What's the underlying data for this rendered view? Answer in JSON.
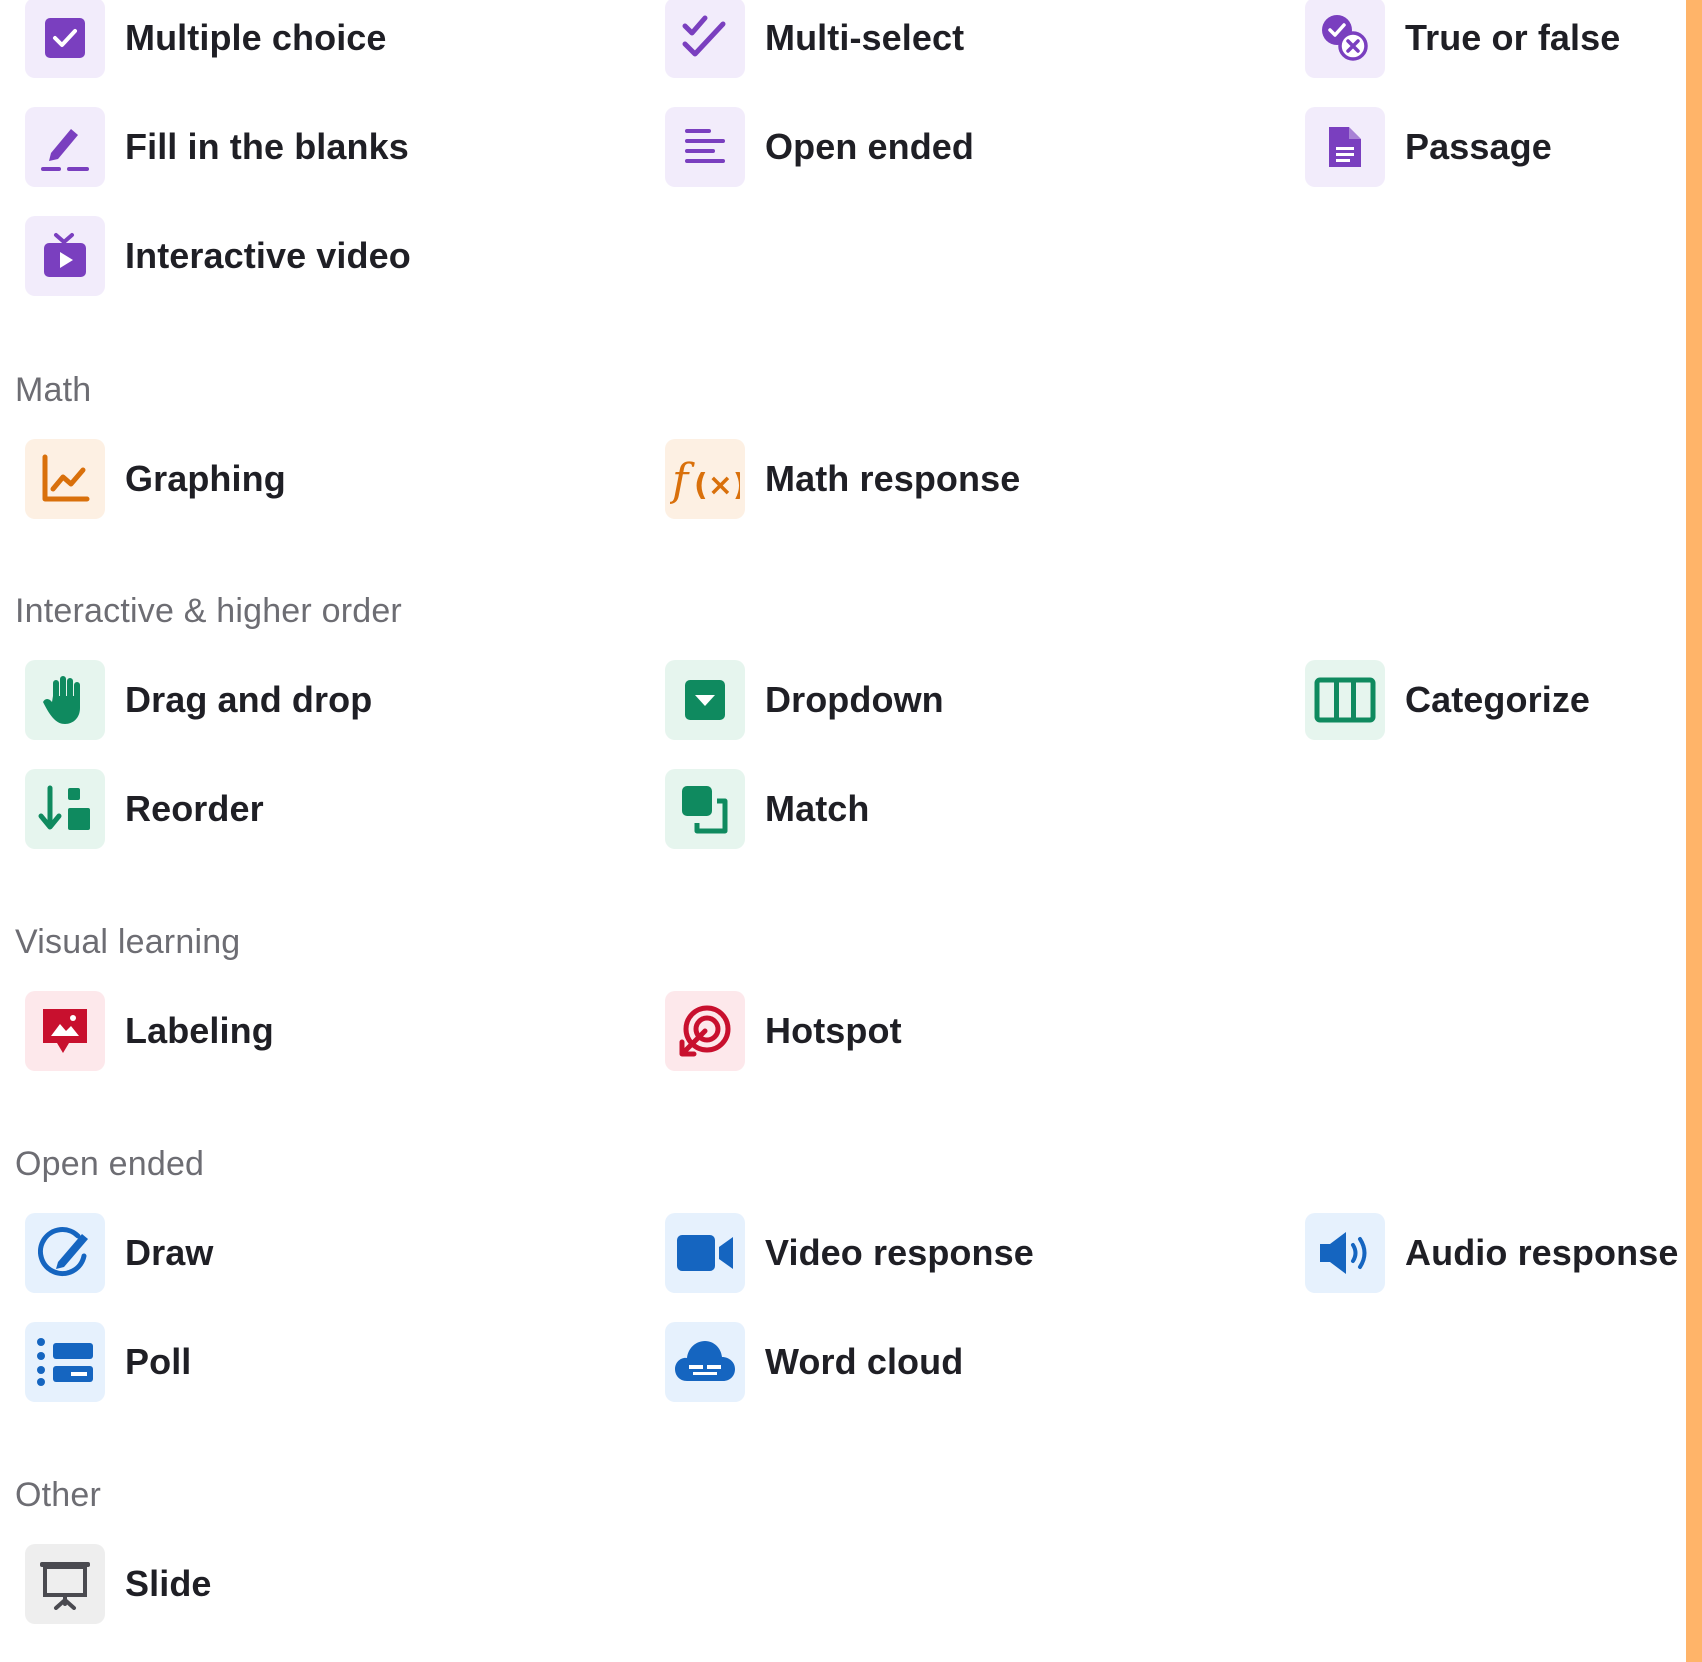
{
  "accent_color": "#ffb469",
  "sections": [
    {
      "title": "",
      "icon_bg": "#f2ecfb",
      "icon_color": "#7a3fbf",
      "items": [
        {
          "label": "Multiple choice",
          "icon": "checkbox-icon"
        },
        {
          "label": "Multi-select",
          "icon": "double-check-icon"
        },
        {
          "label": "True or false",
          "icon": "check-x-icon"
        },
        {
          "label": "Fill in the blanks",
          "icon": "pencil-blank-icon"
        },
        {
          "label": "Open ended",
          "icon": "text-lines-icon"
        },
        {
          "label": "Passage",
          "icon": "document-icon"
        },
        {
          "label": "Interactive video",
          "icon": "tv-play-icon"
        }
      ]
    },
    {
      "title": "Math",
      "icon_bg": "#fdf0e3",
      "icon_color": "#d9700b",
      "items": [
        {
          "label": "Graphing",
          "icon": "line-chart-icon"
        },
        {
          "label": "Math response",
          "icon": "function-icon"
        }
      ]
    },
    {
      "title": "Interactive & higher order",
      "icon_bg": "#e6f5ee",
      "icon_color": "#0f8a5f",
      "items": [
        {
          "label": "Drag and drop",
          "icon": "hand-icon"
        },
        {
          "label": "Dropdown",
          "icon": "dropdown-icon"
        },
        {
          "label": "Categorize",
          "icon": "columns-icon"
        },
        {
          "label": "Reorder",
          "icon": "reorder-icon"
        },
        {
          "label": "Match",
          "icon": "match-icon"
        }
      ]
    },
    {
      "title": "Visual learning",
      "icon_bg": "#fde8eb",
      "icon_color": "#c8102e",
      "items": [
        {
          "label": "Labeling",
          "icon": "image-label-icon"
        },
        {
          "label": "Hotspot",
          "icon": "target-icon"
        }
      ]
    },
    {
      "title": "Open ended",
      "icon_bg": "#e6f1fd",
      "icon_color": "#1565c0",
      "items": [
        {
          "label": "Draw",
          "icon": "draw-icon"
        },
        {
          "label": "Video response",
          "icon": "video-camera-icon"
        },
        {
          "label": "Audio response",
          "icon": "speaker-icon"
        },
        {
          "label": "Poll",
          "icon": "poll-icon"
        },
        {
          "label": "Word cloud",
          "icon": "cloud-icon"
        }
      ]
    },
    {
      "title": "Other",
      "icon_bg": "#eeeeee",
      "icon_color": "#4a4a50",
      "items": [
        {
          "label": "Slide",
          "icon": "presentation-icon"
        }
      ]
    }
  ]
}
